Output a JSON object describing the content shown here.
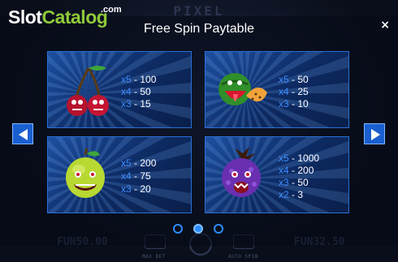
{
  "brand": {
    "part1": "Slot",
    "part2": "Catalog",
    "suffix": ".com"
  },
  "background": {
    "title": "PIXEL",
    "bottom_left_value": "FUN50.00",
    "bottom_right_value": "FUN32.50",
    "max_bet_label": "MAX BET",
    "auto_spin_label": "AUTO SPIN"
  },
  "popup": {
    "title": "Free Spin Paytable",
    "close_label": "×"
  },
  "cards": [
    {
      "symbol": "cherries-monster",
      "pays": [
        {
          "mult": "x5",
          "amt": "- 100"
        },
        {
          "mult": "x4",
          "amt": "- 50"
        },
        {
          "mult": "x3",
          "amt": "- 15"
        }
      ]
    },
    {
      "symbol": "watermelon-monster",
      "pays": [
        {
          "mult": "x5",
          "amt": "- 50"
        },
        {
          "mult": "x4",
          "amt": "- 25"
        },
        {
          "mult": "x3",
          "amt": "- 10"
        }
      ]
    },
    {
      "symbol": "apple-monster",
      "pays": [
        {
          "mult": "x5",
          "amt": "- 200"
        },
        {
          "mult": "x4",
          "amt": "- 75"
        },
        {
          "mult": "x3",
          "amt": "- 20"
        }
      ]
    },
    {
      "symbol": "berry-monster",
      "pays": [
        {
          "mult": "x5",
          "amt": "- 1000"
        },
        {
          "mult": "x4",
          "amt": "- 200"
        },
        {
          "mult": "x3",
          "amt": "- 50"
        },
        {
          "mult": "x2",
          "amt": "- 3"
        }
      ]
    }
  ],
  "pagination": {
    "pages": 3,
    "current": 2
  },
  "colors": {
    "accent": "#2b8cff",
    "multiplier": "#3d8cff",
    "card_border": "#2a6fd8",
    "brand_green": "#8fc93a"
  }
}
